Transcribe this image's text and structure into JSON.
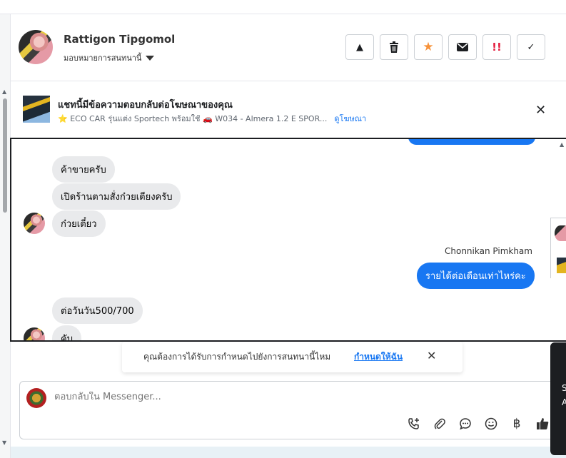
{
  "header": {
    "contact_name": "Rattigon Tipgomol",
    "assign_label": "มอบหมายการสนทนานี้",
    "actions": [
      {
        "icon": "warning-icon",
        "glyph": "▲"
      },
      {
        "icon": "trash-icon",
        "glyph": "🗑"
      },
      {
        "icon": "star-icon",
        "glyph": "★"
      },
      {
        "icon": "mail-icon",
        "glyph": "✉"
      },
      {
        "icon": "urgent-icon",
        "glyph": "!!"
      },
      {
        "icon": "check-icon",
        "glyph": "✓"
      }
    ]
  },
  "ad_banner": {
    "title": "แชทนี้มีข้อความตอบกลับต่อโฆษณาของคุณ",
    "subtitle": "⭐ ECO CAR รุ่นแต่ง Sportech พร้อมใช้ 🚗 W034 - Almera 1.2 E SPOR...",
    "link": "ดูโฆษณา",
    "close": "✕"
  },
  "messages": {
    "in_1": "ค้าขายครับ",
    "in_2": "เปิดร้านตามสั่งก๋วยเตียงครับ",
    "in_3": "ก๋วยเตี๋ยว",
    "sender": "Chonnikan Pimkham",
    "out_1": "รายได้ต่อเดือนเท่าไหร่คะ",
    "in_4": "ต่อวันวัน500/700",
    "in_5": "คับ"
  },
  "reminder": {
    "text": "คุณต้องการได้รับการกำหนดไปยังการสนทนานี้ไหม",
    "link": "กำหนดให้ฉัน",
    "close": "✕"
  },
  "composer": {
    "placeholder": "ตอบกลับใน Messenger...",
    "tools": [
      {
        "icon": "call-add-icon",
        "glyph": "✆"
      },
      {
        "icon": "attachment-icon",
        "glyph": "⌀"
      },
      {
        "icon": "saved-reply-icon",
        "glyph": "💬"
      },
      {
        "icon": "emoji-icon",
        "glyph": "☺"
      },
      {
        "icon": "baht-icon",
        "glyph": "฿"
      },
      {
        "icon": "thumbs-up-icon",
        "glyph": "👍"
      }
    ]
  },
  "side": {
    "dark_text": "S\nA"
  },
  "colors": {
    "accent": "#1877f2",
    "star": "#f7923a",
    "urgent": "#e41e3f"
  }
}
